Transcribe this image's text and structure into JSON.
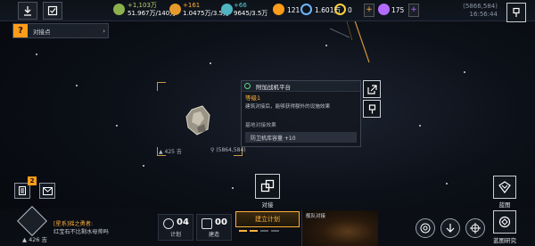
{
  "resources": [
    {
      "delta": "+1,103万",
      "value": "51.967万/140万",
      "color": "#b6d66b"
    },
    {
      "delta": "+161",
      "value": "1.0475万/3.5万",
      "color": "#ffb13b"
    },
    {
      "delta": "+66",
      "value": "9645/3.5万",
      "color": "#5ed3d8"
    }
  ],
  "pills": [
    {
      "value": "121",
      "icon": "energy-icon",
      "color": "#ff9c1a"
    },
    {
      "value": "1.601万",
      "icon": "credits-icon",
      "color": "#6bb7ff"
    },
    {
      "value": "0",
      "icon": "token-icon",
      "color": "#ffd23b"
    },
    {
      "value": "175",
      "icon": "crystal-icon",
      "color": "#b36bff"
    }
  ],
  "coords": {
    "position": "(5866,584)",
    "time": "16:56:44"
  },
  "quest": {
    "mark": "?",
    "text": "对接点"
  },
  "object": {
    "distance": "425 吉",
    "position": "(5864,584)"
  },
  "panel": {
    "title": "附加战机平台",
    "level": "等级1",
    "description": "建筑对接后，能够获得额外的设施效果",
    "section": "基地对接效果",
    "stat": "防卫机库容量 +10"
  },
  "dock": {
    "label": "对接"
  },
  "badge": "2",
  "player": {
    "level": "426 吉"
  },
  "chat": {
    "channel": "[星系]",
    "sender": "摇之勇者:",
    "message": "红宝石不比剩水母帅吗"
  },
  "stats": [
    {
      "num": "04",
      "label": "计划"
    },
    {
      "num": "00",
      "label": "建造"
    }
  ],
  "plan": {
    "label": "建立计划"
  },
  "thumb": {
    "label": "舰队对接"
  },
  "buttons": {
    "map": "蓝图",
    "research": "蓝图研究"
  }
}
